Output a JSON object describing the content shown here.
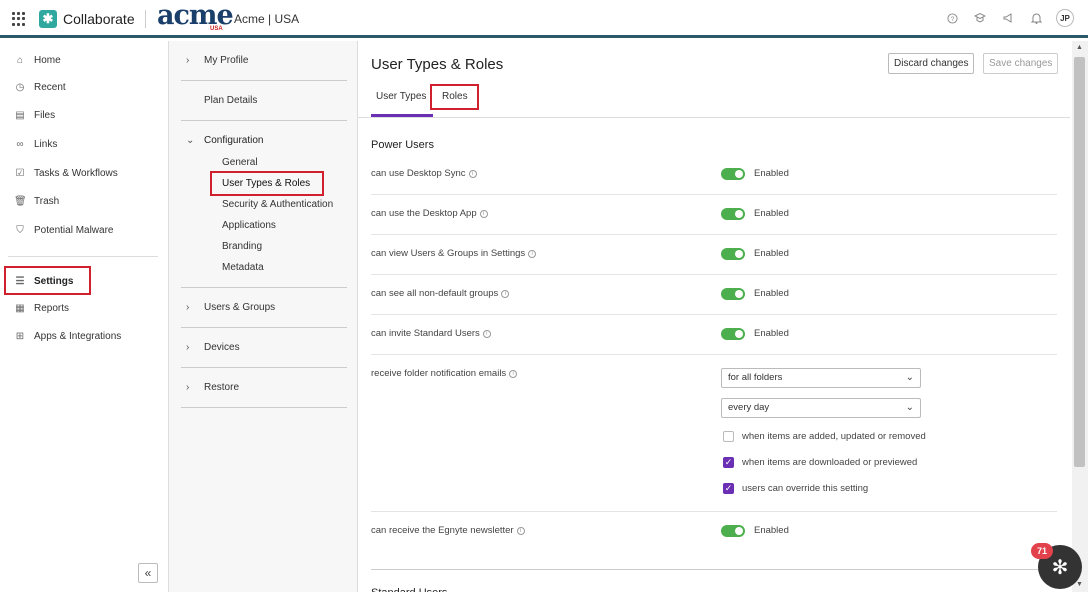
{
  "app": {
    "name": "Collaborate",
    "brand_logo": "acme",
    "brand_sub": "USA",
    "brand_label": "Acme | USA",
    "user_initials": "JP"
  },
  "top_icons": [
    "help-icon",
    "learn-icon",
    "announce-icon",
    "bell-icon"
  ],
  "sidebar": {
    "items": [
      {
        "label": "Home",
        "icon": "home-icon"
      },
      {
        "label": "Recent",
        "icon": "clock-icon"
      },
      {
        "label": "Files",
        "icon": "files-icon"
      },
      {
        "label": "Links",
        "icon": "link-icon"
      },
      {
        "label": "Tasks & Workflows",
        "icon": "tasks-icon"
      },
      {
        "label": "Trash",
        "icon": "trash-icon"
      },
      {
        "label": "Potential Malware",
        "icon": "shield-icon"
      },
      {
        "label": "Settings",
        "icon": "sliders-icon"
      },
      {
        "label": "Reports",
        "icon": "reports-icon"
      },
      {
        "label": "Apps & Integrations",
        "icon": "apps-icon"
      }
    ]
  },
  "settings_menu": {
    "my_profile": "My Profile",
    "plan_details": "Plan Details",
    "configuration": "Configuration",
    "config_items": [
      "General",
      "User Types & Roles",
      "Security & Authentication",
      "Applications",
      "Branding",
      "Metadata"
    ],
    "users_groups": "Users & Groups",
    "devices": "Devices",
    "restore": "Restore"
  },
  "main": {
    "title": "User Types & Roles",
    "discard_label": "Discard changes",
    "save_label": "Save changes",
    "tabs": [
      {
        "label": "User Types"
      },
      {
        "label": "Roles"
      }
    ],
    "section_title": "Power Users",
    "permissions": [
      {
        "label": "can use Desktop Sync",
        "value": "Enabled"
      },
      {
        "label": "can use the Desktop App",
        "value": "Enabled"
      },
      {
        "label": "can view Users & Groups in Settings",
        "value": "Enabled"
      },
      {
        "label": "can see all non-default groups",
        "value": "Enabled"
      },
      {
        "label": "can invite Standard Users",
        "value": "Enabled"
      }
    ],
    "notification": {
      "label": "receive folder notification emails",
      "folders_value": "for all folders",
      "frequency_value": "every day",
      "options": [
        {
          "label": "when items are added, updated or removed",
          "checked": false
        },
        {
          "label": "when items are downloaded or previewed",
          "checked": true
        },
        {
          "label": "users can override this setting",
          "checked": true
        }
      ]
    },
    "newsletter": {
      "label": "can receive the Egnyte newsletter",
      "value": "Enabled"
    },
    "next_section_title": "Standard Users"
  },
  "chat": {
    "badge": "71"
  },
  "colors": {
    "accent": "#6b2fb3",
    "toggle_on": "#4cae4c",
    "highlight": "#d0202e",
    "topbar_border": "#2a5a6a"
  }
}
